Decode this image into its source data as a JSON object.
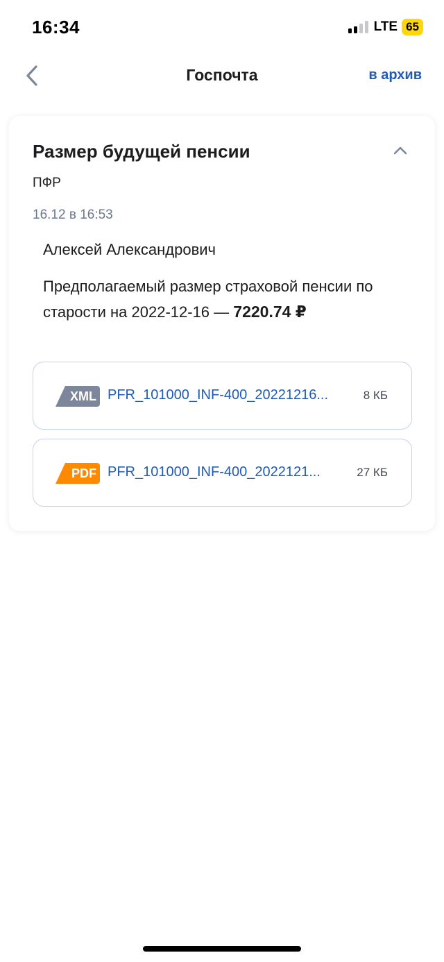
{
  "status_bar": {
    "time": "16:34",
    "network": "LTE",
    "battery": "65",
    "signal_bars_active": 2,
    "signal_bars_total": 4
  },
  "nav": {
    "back_icon": "chevron-left-icon",
    "title": "Госпочта",
    "archive_label": "в архив"
  },
  "message": {
    "title": "Размер будущей пенсии",
    "collapse_icon": "chevron-up-icon",
    "sender": "ПФР",
    "timestamp": "16.12 в 16:53",
    "greeting": "Алексей Александрович",
    "body_text": "Предполагаемый размер страховой пенсии по старости на 2022-12-16 — ",
    "amount": "7220.74 ₽"
  },
  "attachments": [
    {
      "type": "XML",
      "name": "PFR_101000_INF-400_20221216...",
      "size": "8 КБ"
    },
    {
      "type": "PDF",
      "name": "PFR_101000_INF-400_2022121...",
      "size": "27 КБ"
    }
  ],
  "colors": {
    "accent_link": "#1f5bb8",
    "xml_badge": "#7d879b",
    "pdf_badge": "#ff8a00",
    "battery": "#ffd60a",
    "muted_text": "#6b7890"
  }
}
